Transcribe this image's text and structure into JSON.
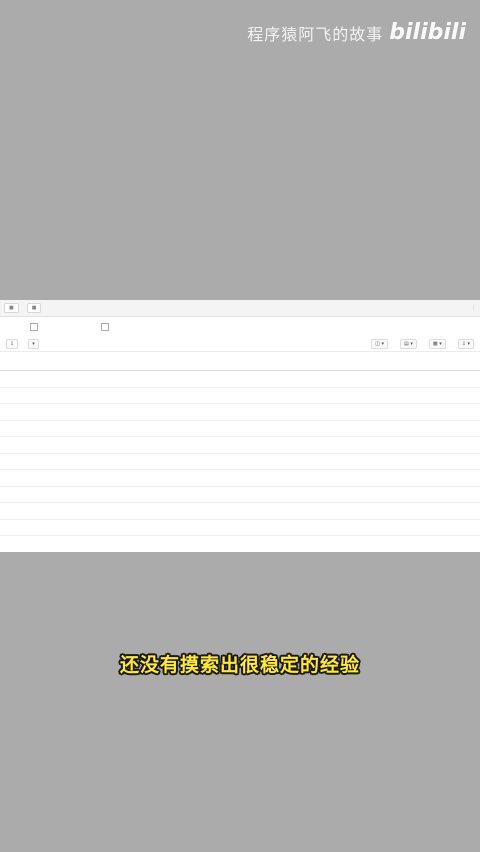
{
  "watermark": {
    "text": "程序猿阿飞的故事",
    "logo": "bilibili"
  },
  "subtitle": "还没有摸索出很稳定的经验",
  "table": {
    "headers": [
      "",
      "",
      "",
      "",
      "",
      "",
      "",
      "",
      "",
      "",
      ""
    ],
    "rows": [
      [
        "",
        "",
        "",
        "",
        "",
        "",
        "",
        "",
        "",
        "",
        ""
      ],
      [
        "",
        "",
        "",
        "",
        "",
        "",
        "",
        "",
        "",
        "",
        ""
      ],
      [
        "",
        "",
        "",
        "",
        "",
        "",
        "",
        "",
        "",
        "",
        ""
      ],
      [
        "",
        "",
        "",
        "",
        "",
        "",
        "",
        "",
        "",
        "",
        ""
      ],
      [
        "",
        "",
        "",
        "",
        "",
        "",
        "",
        "",
        "",
        "",
        ""
      ],
      [
        "",
        "",
        "",
        "",
        "",
        "",
        "",
        "",
        "",
        "",
        ""
      ],
      [
        "",
        "",
        "",
        "",
        "",
        "",
        "",
        "",
        "",
        "",
        ""
      ],
      [
        "",
        "",
        "",
        "",
        "",
        "",
        "",
        "",
        "",
        "",
        ""
      ],
      [
        "",
        "",
        "",
        "",
        "",
        "",
        "",
        "",
        "",
        "",
        ""
      ]
    ],
    "total": [
      "",
      "",
      "",
      "",
      "",
      "",
      "",
      "",
      "",
      "",
      ""
    ]
  }
}
